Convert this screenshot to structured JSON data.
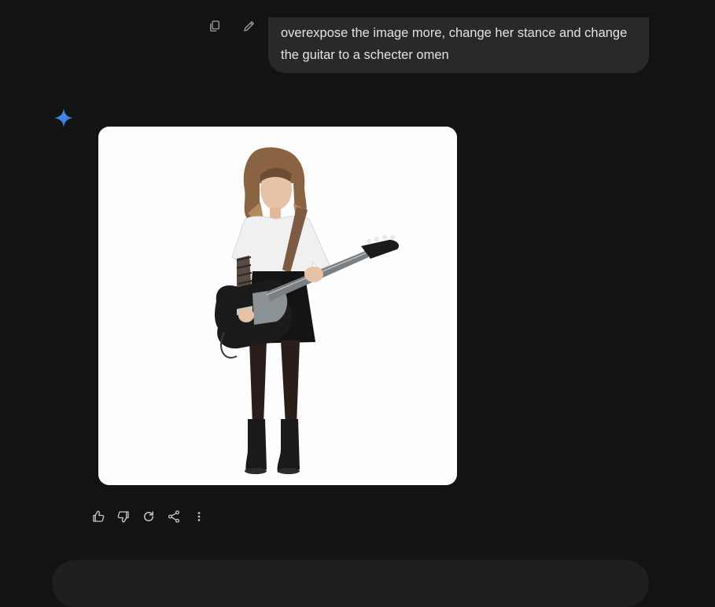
{
  "user_message": {
    "text": "overexpose the image more, change her stance and change the guitar to a schecter omen",
    "actions": [
      {
        "icon": "copy-icon"
      },
      {
        "icon": "edit-icon"
      }
    ]
  },
  "response": {
    "image": {
      "subject": "girl-with-guitar",
      "background_color": "#fdfdfd"
    },
    "actions": [
      {
        "icon": "thumbs-up-icon"
      },
      {
        "icon": "thumbs-down-icon"
      },
      {
        "icon": "regenerate-icon"
      },
      {
        "icon": "share-icon"
      },
      {
        "icon": "more-vert-icon"
      }
    ]
  },
  "colors": {
    "background": "#131314",
    "bubble": "#28292a",
    "text": "#e3e3e3",
    "icon": "#c4c7c5",
    "accent": "#4285f4"
  }
}
